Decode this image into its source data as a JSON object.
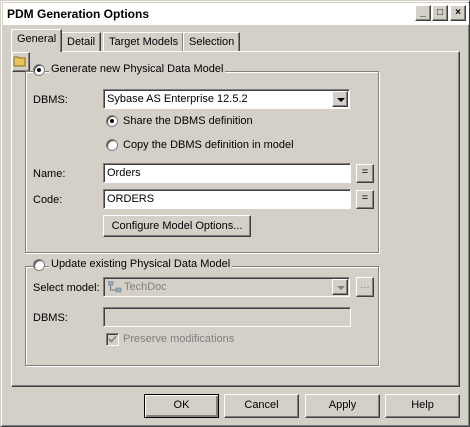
{
  "window": {
    "title": "PDM Generation Options",
    "minimize_glyph": "_",
    "maximize_glyph": "□",
    "close_glyph": "×"
  },
  "tabs": [
    {
      "label": "General",
      "active": true
    },
    {
      "label": "Detail",
      "active": false
    },
    {
      "label": "Target Models",
      "active": false
    },
    {
      "label": "Selection",
      "active": false
    }
  ],
  "generate_group": {
    "radio_label": "Generate new Physical Data Model",
    "dbms_label": "DBMS:",
    "dbms_value": "Sybase AS Enterprise 12.5.2",
    "share_label": "Share the DBMS definition",
    "copy_label": "Copy the DBMS definition in model",
    "name_label": "Name:",
    "name_value": "Orders",
    "code_label": "Code:",
    "code_value": "ORDERS",
    "eq_glyph": "=",
    "configure_button": "Configure Model Options..."
  },
  "update_group": {
    "radio_label": "Update existing Physical Data Model",
    "select_model_label": "Select model:",
    "select_model_value": "TechDoc",
    "browse_glyph": "...",
    "dbms_label": "DBMS:",
    "dbms_value": "",
    "preserve_label": "Preserve modifications"
  },
  "footer": {
    "ok": "OK",
    "cancel": "Cancel",
    "apply": "Apply",
    "help": "Help"
  }
}
